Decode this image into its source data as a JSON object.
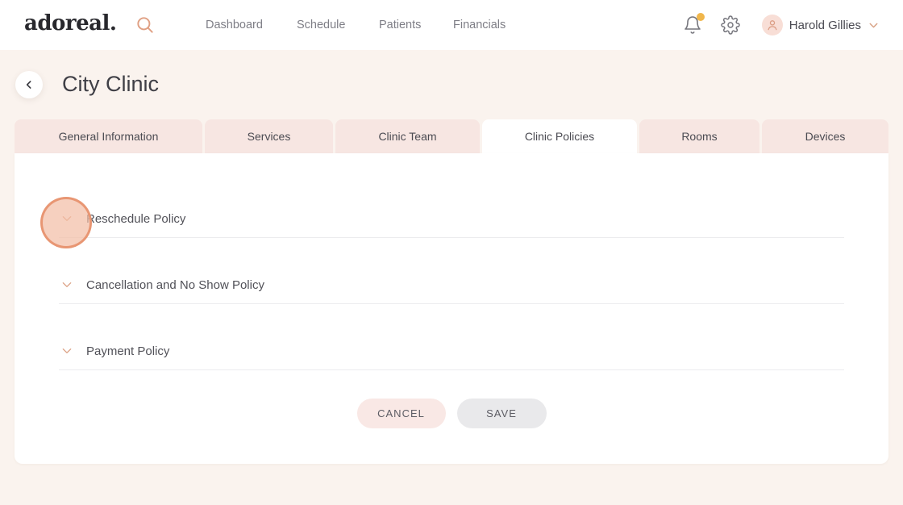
{
  "header": {
    "logo": "adoreal.",
    "nav": [
      {
        "label": "Dashboard"
      },
      {
        "label": "Schedule"
      },
      {
        "label": "Patients"
      },
      {
        "label": "Financials"
      }
    ],
    "icons": {
      "search": "magnifying-glass",
      "bell": "notification-bell",
      "bell_badge": "unread-dot",
      "gear": "settings-gear",
      "avatar": "user-person",
      "user_chevron": "chevron-down"
    },
    "user": {
      "name": "Harold Gillies",
      "has_notification": true
    }
  },
  "page": {
    "back_icon": "chevron-left",
    "title": "City Clinic"
  },
  "tabs": [
    {
      "label": "General Information",
      "active": false
    },
    {
      "label": "Services",
      "active": false
    },
    {
      "label": "Clinic Team",
      "active": false
    },
    {
      "label": "Clinic Policies",
      "active": true
    },
    {
      "label": "Rooms",
      "active": false
    },
    {
      "label": "Devices",
      "active": false
    }
  ],
  "policies": [
    {
      "label": "Reschedule Policy",
      "icon": "chevron-down",
      "expanded": false,
      "highlighted": true
    },
    {
      "label": "Cancellation and No Show Policy",
      "icon": "chevron-down",
      "expanded": false,
      "highlighted": false
    },
    {
      "label": "Payment Policy",
      "icon": "chevron-down",
      "expanded": false,
      "highlighted": false
    }
  ],
  "actions": {
    "cancel_label": "CANCEL",
    "save_label": "SAVE"
  },
  "colors": {
    "page_background": "#FAF3EE",
    "header_background": "#FFFFFF",
    "tab_inactive": "#F7E6E2",
    "tab_active": "#FFFFFF",
    "accent_peach": "#DDA287",
    "notification_dot": "#F0B64B",
    "avatar_background": "#F8DED6",
    "cancel_button": "#F9E8E5",
    "save_button": "#E9E9EB",
    "divider": "#ECECEE",
    "text_dark": "#3F3F46",
    "text_gray": "#7E7E86",
    "highlight_circle": "#E89470"
  }
}
